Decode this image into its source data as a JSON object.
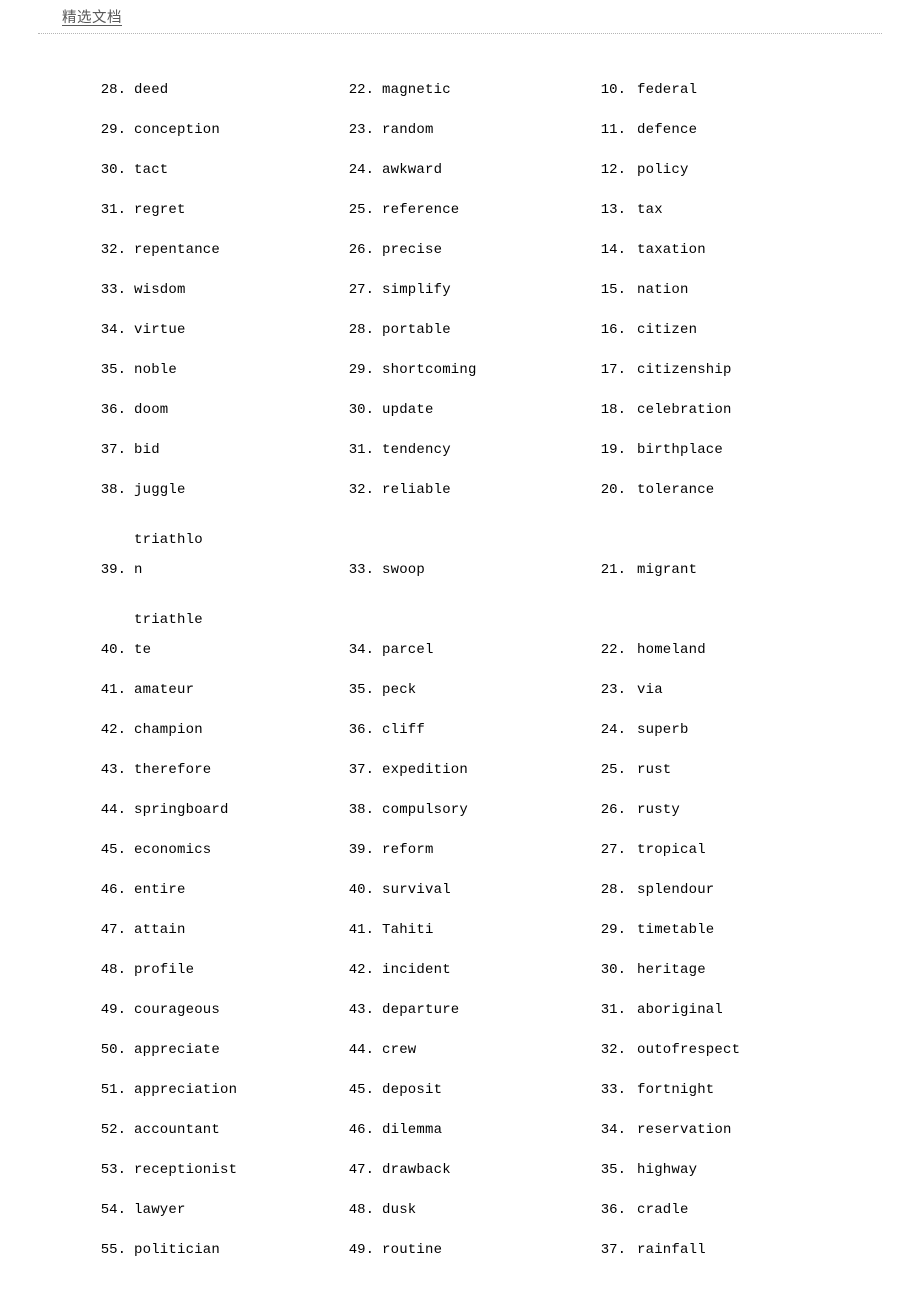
{
  "header": {
    "title": "精选文档",
    "rule_color": "#b5b5b5",
    "title_color": "#595959"
  },
  "columns": [
    {
      "id": "column-1",
      "items": [
        {
          "number": "28.",
          "word": "deed"
        },
        {
          "number": "29.",
          "word": "conception"
        },
        {
          "number": "30.",
          "word": "tact"
        },
        {
          "number": "31.",
          "word": "regret"
        },
        {
          "number": "32.",
          "word": "repentance"
        },
        {
          "number": "33.",
          "word": "wisdom"
        },
        {
          "number": "34.",
          "word": "virtue"
        },
        {
          "number": "35.",
          "word": "noble"
        },
        {
          "number": "36.",
          "word": "doom"
        },
        {
          "number": "37.",
          "word": "bid"
        },
        {
          "number": "38.",
          "word": "juggle"
        },
        {
          "number": "39.",
          "word": "triathlon",
          "wrapped": true
        },
        {
          "number": "40.",
          "word": "triathlete",
          "wrapped": true
        },
        {
          "number": "41.",
          "word": "amateur"
        },
        {
          "number": "42.",
          "word": "champion"
        },
        {
          "number": "43.",
          "word": "therefore"
        },
        {
          "number": "44.",
          "word": "springboard"
        },
        {
          "number": "45.",
          "word": "economics"
        },
        {
          "number": "46.",
          "word": "entire"
        },
        {
          "number": "47.",
          "word": "attain"
        },
        {
          "number": "48.",
          "word": "profile"
        },
        {
          "number": "49.",
          "word": "courageous"
        },
        {
          "number": "50.",
          "word": "appreciate"
        },
        {
          "number": "51.",
          "word": "appreciation"
        },
        {
          "number": "52.",
          "word": "accountant"
        },
        {
          "number": "53.",
          "word": "receptionist"
        },
        {
          "number": "54.",
          "word": "lawyer"
        },
        {
          "number": "55.",
          "word": "politician"
        }
      ]
    },
    {
      "id": "column-2",
      "items": [
        {
          "number": "22.",
          "word": "magnetic"
        },
        {
          "number": "23.",
          "word": "random"
        },
        {
          "number": "24.",
          "word": "awkward"
        },
        {
          "number": "25.",
          "word": "reference"
        },
        {
          "number": "26.",
          "word": "precise"
        },
        {
          "number": "27.",
          "word": "simplify"
        },
        {
          "number": "28.",
          "word": "portable"
        },
        {
          "number": "29.",
          "word": "shortcoming"
        },
        {
          "number": "30.",
          "word": "update"
        },
        {
          "number": "31.",
          "word": "tendency"
        },
        {
          "number": "32.",
          "word": "reliable"
        },
        {
          "number": "33.",
          "word": "swoop",
          "tall": true
        },
        {
          "number": "34.",
          "word": "parcel",
          "tall": true
        },
        {
          "number": "35.",
          "word": "peck"
        },
        {
          "number": "36.",
          "word": "cliff"
        },
        {
          "number": "37.",
          "word": "expedition"
        },
        {
          "number": "38.",
          "word": "compulsory"
        },
        {
          "number": "39.",
          "word": "reform"
        },
        {
          "number": "40.",
          "word": "survival"
        },
        {
          "number": "41.",
          "word": "Tahiti"
        },
        {
          "number": "42.",
          "word": "incident"
        },
        {
          "number": "43.",
          "word": "departure"
        },
        {
          "number": "44.",
          "word": "crew"
        },
        {
          "number": "45.",
          "word": "deposit"
        },
        {
          "number": "46.",
          "word": "dilemma"
        },
        {
          "number": "47.",
          "word": "drawback"
        },
        {
          "number": "48.",
          "word": "dusk"
        },
        {
          "number": "49.",
          "word": "routine"
        }
      ]
    },
    {
      "id": "column-3",
      "items": [
        {
          "number": "10.",
          "word": "federal"
        },
        {
          "number": "11.",
          "word": "defence"
        },
        {
          "number": "12.",
          "word": "policy"
        },
        {
          "number": "13.",
          "word": "tax"
        },
        {
          "number": "14.",
          "word": "taxation"
        },
        {
          "number": "15.",
          "word": "nation"
        },
        {
          "number": "16.",
          "word": "citizen"
        },
        {
          "number": "17.",
          "word": "citizenship"
        },
        {
          "number": "18.",
          "word": "celebration"
        },
        {
          "number": "19.",
          "word": "birthplace"
        },
        {
          "number": "20.",
          "word": "tolerance"
        },
        {
          "number": "21.",
          "word": "migrant",
          "tall": true
        },
        {
          "number": "22.",
          "word": "homeland",
          "tall": true
        },
        {
          "number": "23.",
          "word": "via"
        },
        {
          "number": "24.",
          "word": "superb"
        },
        {
          "number": "25.",
          "word": "rust"
        },
        {
          "number": "26.",
          "word": "rusty"
        },
        {
          "number": "27.",
          "word": "tropical"
        },
        {
          "number": "28.",
          "word": "splendour"
        },
        {
          "number": "29.",
          "word": "timetable"
        },
        {
          "number": "30.",
          "word": "heritage"
        },
        {
          "number": "31.",
          "word": "aboriginal"
        },
        {
          "number": "32.",
          "word": "outofrespect"
        },
        {
          "number": "33.",
          "word": "fortnight"
        },
        {
          "number": "34.",
          "word": "reservation"
        },
        {
          "number": "35.",
          "word": "highway"
        },
        {
          "number": "36.",
          "word": "cradle"
        },
        {
          "number": "37.",
          "word": "rainfall"
        }
      ]
    }
  ]
}
